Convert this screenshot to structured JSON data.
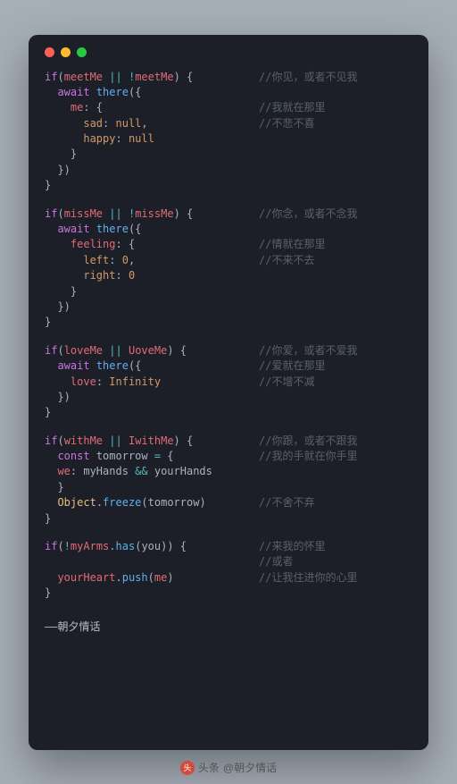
{
  "traffic": {
    "red": "#fe5f57",
    "yellow": "#febc2e",
    "green": "#28c840"
  },
  "blocks": [
    {
      "lines": [
        {
          "tokens": [
            [
              "kw",
              "if"
            ],
            [
              "pn",
              "("
            ],
            [
              "id",
              "meetMe"
            ],
            [
              "pn",
              " "
            ],
            [
              "op",
              "||"
            ],
            [
              "pn",
              " "
            ],
            [
              "op",
              "!"
            ],
            [
              "id",
              "meetMe"
            ],
            [
              "pn",
              ") {"
            ]
          ],
          "comment": "//你见，或者不见我"
        },
        {
          "indent": 1,
          "tokens": [
            [
              "kw",
              "await"
            ],
            [
              "pn",
              " "
            ],
            [
              "fn",
              "there"
            ],
            [
              "pn",
              "({"
            ]
          ],
          "comment": ""
        },
        {
          "indent": 2,
          "tokens": [
            [
              "key",
              "me"
            ],
            [
              "pn",
              ": {"
            ]
          ],
          "comment": "//我就在那里"
        },
        {
          "indent": 3,
          "tokens": [
            [
              "key2",
              "sad"
            ],
            [
              "pn",
              ": "
            ],
            [
              "val",
              "null"
            ],
            [
              "pn",
              ","
            ]
          ],
          "comment": "//不悲不喜"
        },
        {
          "indent": 3,
          "tokens": [
            [
              "key2",
              "happy"
            ],
            [
              "pn",
              ": "
            ],
            [
              "val",
              "null"
            ]
          ],
          "comment": ""
        },
        {
          "indent": 2,
          "tokens": [
            [
              "pn",
              "}"
            ]
          ],
          "comment": ""
        },
        {
          "indent": 1,
          "tokens": [
            [
              "pn",
              "})"
            ]
          ],
          "comment": ""
        },
        {
          "tokens": [
            [
              "pn",
              "}"
            ]
          ],
          "comment": ""
        }
      ]
    },
    {
      "lines": [
        {
          "tokens": [
            [
              "kw",
              "if"
            ],
            [
              "pn",
              "("
            ],
            [
              "id",
              "missMe"
            ],
            [
              "pn",
              " "
            ],
            [
              "op",
              "||"
            ],
            [
              "pn",
              " "
            ],
            [
              "op",
              "!"
            ],
            [
              "id",
              "missMe"
            ],
            [
              "pn",
              ") {"
            ]
          ],
          "comment": "//你念，或者不念我"
        },
        {
          "indent": 1,
          "tokens": [
            [
              "kw",
              "await"
            ],
            [
              "pn",
              " "
            ],
            [
              "fn",
              "there"
            ],
            [
              "pn",
              "({"
            ]
          ],
          "comment": ""
        },
        {
          "indent": 2,
          "tokens": [
            [
              "key",
              "feeling"
            ],
            [
              "pn",
              ": {"
            ]
          ],
          "comment": "//情就在那里"
        },
        {
          "indent": 3,
          "tokens": [
            [
              "key2",
              "left"
            ],
            [
              "pn",
              ": "
            ],
            [
              "val",
              "0"
            ],
            [
              "pn",
              ","
            ]
          ],
          "comment": "//不来不去"
        },
        {
          "indent": 3,
          "tokens": [
            [
              "key2",
              "right"
            ],
            [
              "pn",
              ": "
            ],
            [
              "val",
              "0"
            ]
          ],
          "comment": ""
        },
        {
          "indent": 2,
          "tokens": [
            [
              "pn",
              "}"
            ]
          ],
          "comment": ""
        },
        {
          "indent": 1,
          "tokens": [
            [
              "pn",
              "})"
            ]
          ],
          "comment": ""
        },
        {
          "tokens": [
            [
              "pn",
              "}"
            ]
          ],
          "comment": ""
        }
      ]
    },
    {
      "lines": [
        {
          "tokens": [
            [
              "kw",
              "if"
            ],
            [
              "pn",
              "("
            ],
            [
              "id",
              "loveMe"
            ],
            [
              "pn",
              " "
            ],
            [
              "op",
              "||"
            ],
            [
              "pn",
              " "
            ],
            [
              "id",
              "UoveMe"
            ],
            [
              "pn",
              ") {"
            ]
          ],
          "comment": "//你爱，或者不爱我"
        },
        {
          "indent": 1,
          "tokens": [
            [
              "kw",
              "await"
            ],
            [
              "pn",
              " "
            ],
            [
              "fn",
              "there"
            ],
            [
              "pn",
              "({"
            ]
          ],
          "comment": "//爱就在那里"
        },
        {
          "indent": 2,
          "tokens": [
            [
              "key",
              "love"
            ],
            [
              "pn",
              ": "
            ],
            [
              "val",
              "Infinity"
            ]
          ],
          "comment": "//不增不减"
        },
        {
          "indent": 1,
          "tokens": [
            [
              "pn",
              "})"
            ]
          ],
          "comment": ""
        },
        {
          "tokens": [
            [
              "pn",
              "}"
            ]
          ],
          "comment": ""
        }
      ]
    },
    {
      "lines": [
        {
          "tokens": [
            [
              "kw",
              "if"
            ],
            [
              "pn",
              "("
            ],
            [
              "id",
              "withMe"
            ],
            [
              "pn",
              " "
            ],
            [
              "op",
              "||"
            ],
            [
              "pn",
              " "
            ],
            [
              "id",
              "IwithMe"
            ],
            [
              "pn",
              ") {"
            ]
          ],
          "comment": "//你跟，或者不跟我"
        },
        {
          "indent": 1,
          "tokens": [
            [
              "kw",
              "const"
            ],
            [
              "pn",
              " "
            ],
            [
              "txt",
              "tomorrow"
            ],
            [
              "pn",
              " "
            ],
            [
              "op",
              "="
            ],
            [
              "pn",
              " {"
            ]
          ],
          "comment": "//我的手就在你手里"
        },
        {
          "indent": 1,
          "tokens": [
            [
              "key",
              "we"
            ],
            [
              "pn",
              ": "
            ],
            [
              "txt",
              "myHands"
            ],
            [
              "pn",
              " "
            ],
            [
              "op",
              "&&"
            ],
            [
              "pn",
              " "
            ],
            [
              "txt",
              "yourHands"
            ]
          ],
          "comment": ""
        },
        {
          "indent": 1,
          "tokens": [
            [
              "pn",
              "}"
            ]
          ],
          "comment": ""
        },
        {
          "indent": 1,
          "tokens": [
            [
              "obj",
              "Object"
            ],
            [
              "pn",
              "."
            ],
            [
              "fn",
              "freeze"
            ],
            [
              "pn",
              "("
            ],
            [
              "txt",
              "tomorrow"
            ],
            [
              "pn",
              ")"
            ]
          ],
          "comment": "//不舍不弃"
        },
        {
          "tokens": [
            [
              "pn",
              "}"
            ]
          ],
          "comment": ""
        }
      ]
    },
    {
      "lines": [
        {
          "tokens": [
            [
              "kw",
              "if"
            ],
            [
              "pn",
              "("
            ],
            [
              "op",
              "!"
            ],
            [
              "id",
              "myArms"
            ],
            [
              "pn",
              "."
            ],
            [
              "fn",
              "has"
            ],
            [
              "pn",
              "("
            ],
            [
              "txt",
              "you"
            ],
            [
              "pn",
              ")) {"
            ]
          ],
          "comment": "//来我的怀里"
        },
        {
          "tokens": [],
          "comment": "//或者"
        },
        {
          "indent": 1,
          "tokens": [
            [
              "id",
              "yourHeart"
            ],
            [
              "pn",
              "."
            ],
            [
              "fn",
              "push"
            ],
            [
              "pn",
              "("
            ],
            [
              "id",
              "me"
            ],
            [
              "pn",
              ")"
            ]
          ],
          "comment": "//让我住进你的心里"
        },
        {
          "tokens": [
            [
              "pn",
              "}"
            ]
          ],
          "comment": ""
        }
      ]
    }
  ],
  "signature": "——朝夕情话",
  "footer": {
    "logo": "头",
    "source_label": "头条",
    "author": "@朝夕情话"
  }
}
